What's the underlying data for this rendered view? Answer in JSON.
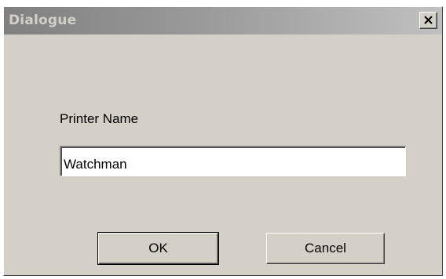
{
  "window": {
    "title": "Dialogue",
    "close_icon": "close-icon"
  },
  "form": {
    "printer_label": "Printer Name",
    "printer_value": "Watchman"
  },
  "buttons": {
    "ok_label": "OK",
    "cancel_label": "Cancel"
  },
  "colors": {
    "face": "#d4d0c8",
    "title_gradient_start": "#808080",
    "title_gradient_end": "#c0c0c0"
  }
}
